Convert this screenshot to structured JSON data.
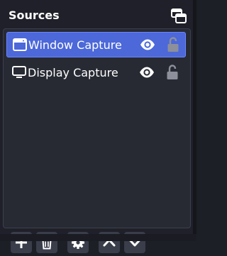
{
  "dock": {
    "title": "Sources",
    "undock_icon": "undock-icon"
  },
  "sources": [
    {
      "label": "Window Capture",
      "type_icon": "window-capture-icon",
      "selected": true,
      "visible": true,
      "locked": false
    },
    {
      "label": "Display Capture",
      "type_icon": "display-capture-icon",
      "selected": false,
      "visible": true,
      "locked": false
    }
  ],
  "toolbar": {
    "add_icon": "plus-icon",
    "remove_icon": "trash-icon",
    "settings_icon": "gear-icon",
    "move_up_icon": "chevron-up-icon",
    "move_down_icon": "chevron-down-icon"
  },
  "colors": {
    "background": "#1f2029",
    "panel": "#272a33",
    "selection": "#4c68d9",
    "button": "#3a3d4a",
    "text": "#ffffff",
    "muted_icon": "#8d909a"
  }
}
